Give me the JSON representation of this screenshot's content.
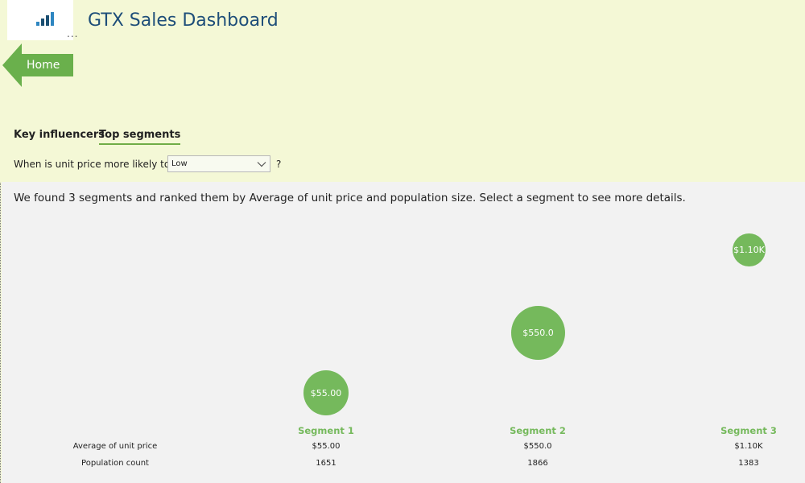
{
  "header": {
    "title": "GTX Sales Dashboard",
    "more_glyph": "...",
    "home_label": "Home"
  },
  "tabs": [
    {
      "label": "Key influencers",
      "active": false
    },
    {
      "label": "Top segments",
      "active": true
    }
  ],
  "question": {
    "prefix": "When is unit price more likely to be",
    "selected": "Low",
    "suffix": "?"
  },
  "summary": "We found 3 segments and ranked them by Average of unit price and population size. Select a segment to see more details.",
  "table": {
    "row_labels": [
      "Average of unit price",
      "Population count"
    ]
  },
  "segments": [
    {
      "name": "Segment 1",
      "bubble_label": "$55.00",
      "avg_unit_price": "$55.00",
      "population": "1651"
    },
    {
      "name": "Segment 2",
      "bubble_label": "$550.0",
      "avg_unit_price": "$550.0",
      "population": "1866"
    },
    {
      "name": "Segment 3",
      "bubble_label": "$1.10K",
      "avg_unit_price": "$1.10K",
      "population": "1383"
    }
  ],
  "colors": {
    "accent": "#75b95c",
    "title": "#1e4e79",
    "top_bg": "#f4f8d6",
    "main_bg": "#f2f2f2"
  }
}
